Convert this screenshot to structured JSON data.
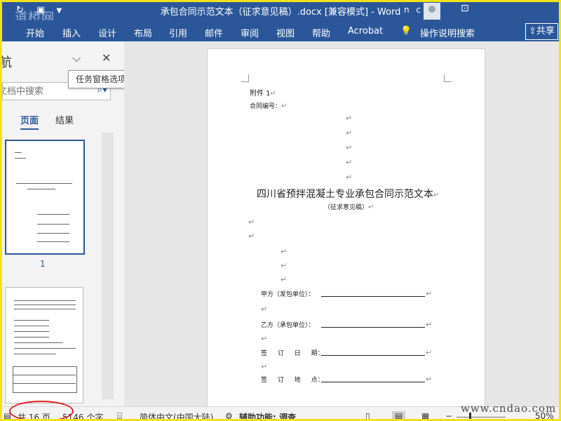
{
  "window": {
    "title": "承包合同示范文本（征求意见稿）.docx [兼容模式]  -  Word",
    "watermark_left": "道桥网",
    "user_initials": "n c",
    "share_label": "共享"
  },
  "ribbon": {
    "tabs": [
      "开始",
      "插入",
      "设计",
      "布局",
      "引用",
      "邮件",
      "审阅",
      "视图",
      "帮助",
      "Acrobat"
    ],
    "tell_me": "操作说明搜索"
  },
  "nav_pane": {
    "title": "导航",
    "search_placeholder": "在文档中搜索",
    "tab_pages": "页面",
    "tab_results": "结果",
    "thumb_page_number": "1",
    "tooltip": "任务窗格选项"
  },
  "document": {
    "attachment": "附件 1",
    "contract_no": "合同编号：",
    "main_title": "四川省预拌混凝土专业承包合同示范文本",
    "subtitle": "（征求意见稿）",
    "party_a": "甲方（发包单位）：",
    "party_b": "乙方（承包单位）：",
    "sign_date": "签 订 日 期：",
    "sign_place": "签 订 地 点：",
    "para_mark": "↵"
  },
  "statusbar": {
    "page_info": "共 16 页",
    "word_count": "5146 个字",
    "language": "简体中文(中国大陆)",
    "accessibility": "辅助功能: 调查",
    "zoom": "50%",
    "watermark_right": "www.cndao.com"
  },
  "colors": {
    "word_blue": "#2b579a",
    "annotation_red": "#e02020",
    "frame_yellow": "#f2e21a"
  }
}
